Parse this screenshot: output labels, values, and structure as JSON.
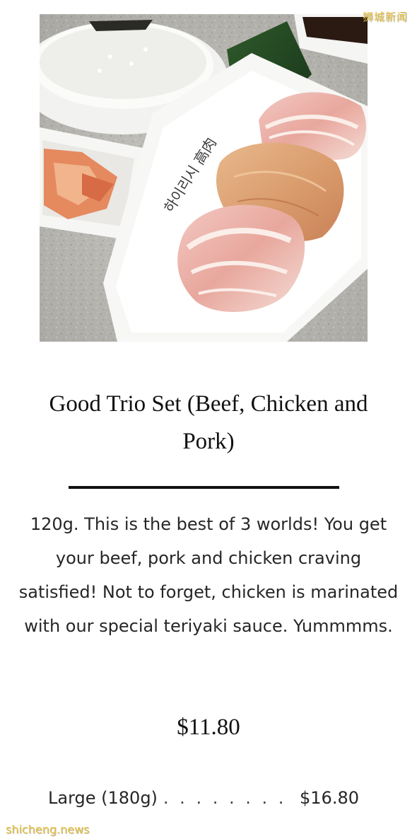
{
  "watermark": {
    "top_right": "狮城新闻",
    "bottom_left": "shicheng.news"
  },
  "photo": {
    "alt": "Good Trio Set plated with rice, kimchi, beef, chicken and pork",
    "plate_lettering": "하이리시 高肉"
  },
  "product": {
    "title": "Good Trio Set (Beef, Chicken and Pork)",
    "description": "120g. This is the best of 3 worlds! You get your beef, pork and chicken craving satisfied! Not to forget, chicken is marinated with our special teriyaki sauce. Yummmms.",
    "price": "$11.80",
    "variant": {
      "label": "Large (180g)",
      "dots": ". . . . . . . . . . . . . . . . . . . . . . .",
      "price": "$16.80"
    }
  },
  "colors": {
    "watermark": "#e8c23a",
    "text": "#262626",
    "divider": "#111111"
  }
}
